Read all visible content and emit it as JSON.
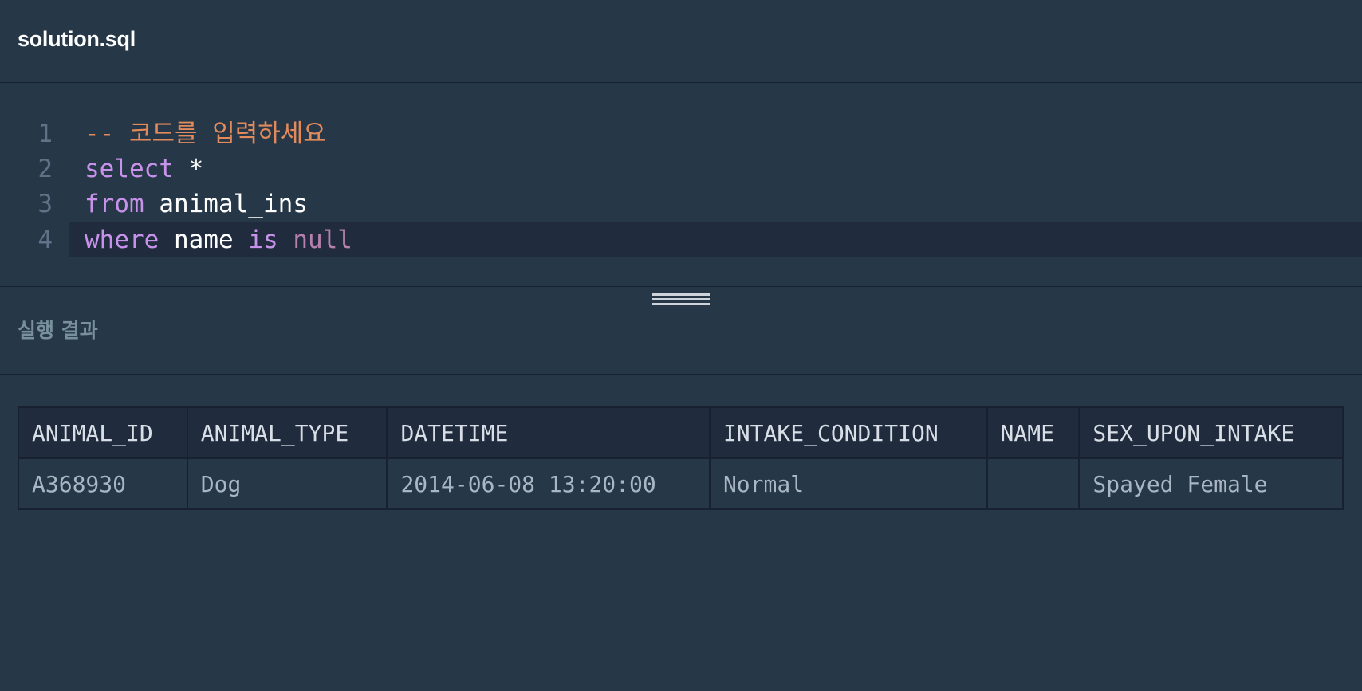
{
  "file": {
    "title": "solution.sql"
  },
  "editor": {
    "lines": [
      {
        "number": "1",
        "tokens": [
          {
            "type": "comment",
            "text": "-- 코드를 입력하세요"
          }
        ]
      },
      {
        "number": "2",
        "tokens": [
          {
            "type": "keyword",
            "text": "select"
          },
          {
            "type": "ident",
            "text": " *"
          }
        ]
      },
      {
        "number": "3",
        "tokens": [
          {
            "type": "keyword",
            "text": "from"
          },
          {
            "type": "ident",
            "text": " animal_ins"
          }
        ]
      },
      {
        "number": "4",
        "tokens": [
          {
            "type": "keyword",
            "text": "where"
          },
          {
            "type": "ident",
            "text": " name "
          },
          {
            "type": "keyword",
            "text": "is"
          },
          {
            "type": "ident",
            "text": " "
          },
          {
            "type": "null",
            "text": "null"
          }
        ]
      }
    ],
    "active_line": 4
  },
  "colors": {
    "background": "#263747",
    "comment": "#e28a5b",
    "keyword": "#c792ea",
    "null": "#b67fae"
  },
  "results": {
    "title": "실행 결과",
    "columns": [
      "ANIMAL_ID",
      "ANIMAL_TYPE",
      "DATETIME",
      "INTAKE_CONDITION",
      "NAME",
      "SEX_UPON_INTAKE"
    ],
    "rows": [
      [
        "A368930",
        "Dog",
        "2014-06-08 13:20:00",
        "Normal",
        "",
        "Spayed Female"
      ]
    ]
  }
}
